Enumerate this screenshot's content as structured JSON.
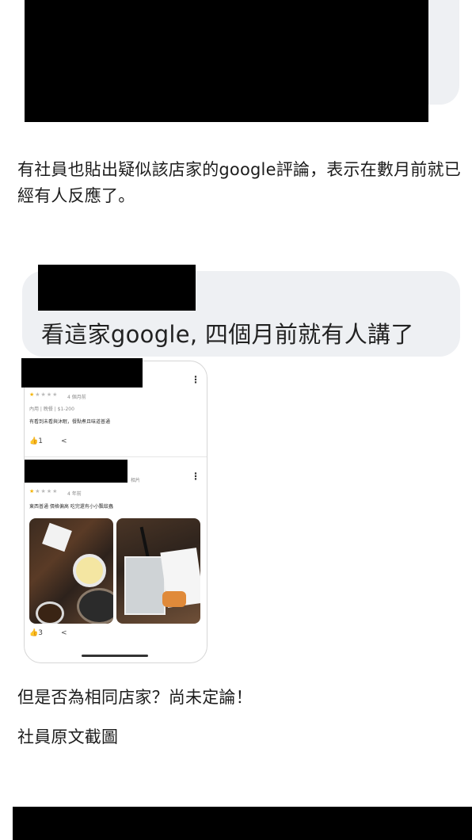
{
  "article": {
    "paragraph1": "有社員也貼出疑似該店家的google評論，表示在數月前就已經有人反應了。",
    "paragraph2": "但是否為相同店家？尚未定論！",
    "caption": "社員原文截圖"
  },
  "comment": {
    "text": "看這家google, 四個月前就有人講了"
  },
  "reviews": [
    {
      "time": "4 個月前",
      "meta": "內用 | 晚餐 | $1-200",
      "body": "有看到未看與沐眠，餐點煮且味道普通",
      "likes": "1",
      "stars": 1
    },
    {
      "time": "4 年前",
      "body": "東西普通 價格偏高 吃完還有小小飄蚊蟲",
      "likes": "3",
      "stars": 1
    }
  ],
  "icons": {
    "more": "kebab-menu-icon",
    "like": "thumbs-up-icon",
    "share": "share-icon"
  },
  "colors": {
    "star": "#f4b400",
    "bubble": "#eef0f3",
    "redaction": "#000000"
  }
}
